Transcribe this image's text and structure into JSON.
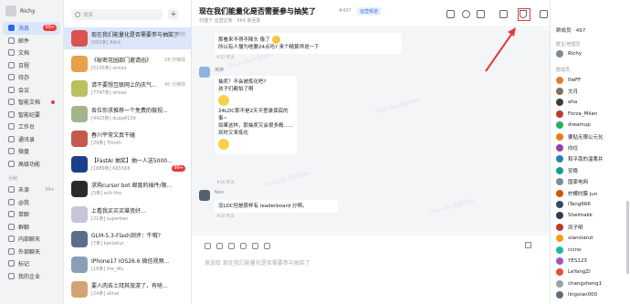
{
  "profile": {
    "name": "Richy"
  },
  "nav": {
    "items": [
      {
        "label": "消息",
        "badge": "99+",
        "active": true
      },
      {
        "label": "邮件"
      },
      {
        "label": "文档"
      },
      {
        "label": "日程"
      },
      {
        "label": "待办"
      },
      {
        "label": "会议"
      },
      {
        "label": "智能文档",
        "dot": true
      },
      {
        "label": "智能纪要"
      },
      {
        "label": "工作台"
      },
      {
        "label": "通讯录"
      },
      {
        "label": "微盘"
      },
      {
        "label": "高级功能"
      }
    ],
    "group_label": "分组",
    "groups": [
      {
        "label": "未读",
        "count": "99+"
      },
      {
        "label": "@我"
      },
      {
        "label": "单聊"
      },
      {
        "label": "群聊"
      },
      {
        "label": "内部聊天"
      },
      {
        "label": "外部聊天"
      },
      {
        "label": "标记"
      },
      {
        "label": "我的企业"
      }
    ]
  },
  "conversations": {
    "search_placeholder": "搜索",
    "add_label": "+",
    "items": [
      {
        "title": "现在我们能量化是否需要参与抽奖了",
        "sub": "[562条] Aitck",
        "time": "5 分钟前",
        "selected": true,
        "color": "#d9534f"
      },
      {
        "title": "《秘密花园部门邀请函》",
        "sub": "[5105条] xmiao",
        "time": "28 分钟前",
        "color": "#e8a04a"
      },
      {
        "title": "请不要想互联网上的庆气...",
        "sub": "[7747条] xmiao",
        "time": "40 分钟前",
        "color": "#b9c05e"
      },
      {
        "title": "各位你求推荐一个免费的做视...",
        "sub": "[4423条] duqq4139",
        "time": "",
        "color": "#a4b48e"
      },
      {
        "title": "春川平常文真干磕",
        "sub": "[29条] Throth",
        "time": "",
        "color": "#c25b4b"
      },
      {
        "title": "【FastAI 抽奖】抽一人送5000...",
        "sub": "[1889条] KK5566",
        "time": "",
        "badge": "99+",
        "color": "#1c3f8c"
      },
      {
        "title": "求购cursor bot 邮度的插件/限...",
        "sub": "[5条] erik-fire",
        "time": "",
        "color": "#2b2b2b"
      },
      {
        "title": "上看我买买买堪资好...",
        "sub": "[21条] superben",
        "time": "",
        "color": "#c7c3d8"
      },
      {
        "title": "GLM-5.3-Flash测评：牛哦?",
        "sub": "[7条] kanlatlur",
        "time": "",
        "color": "#5a6d8a"
      },
      {
        "title": "IPhone17 IOS26.6 微信视频...",
        "sub": "[18条] the_Wu",
        "time": "",
        "color": "#8a9fb7"
      },
      {
        "title": "要人肉去土拜其旅游了，有啥...",
        "sub": "[24条] alinai",
        "time": "",
        "color": "#d4a373"
      }
    ]
  },
  "chat": {
    "title": "现在我们能量化是否需要参与抽奖了",
    "number": "#497",
    "tag": "运营频道",
    "subtitle": "扫描下 运营这条 · 564 条回复",
    "msg1": {
      "text1": "那看来不得不降头 像了",
      "text2": "所以有人懂为啥要24点吗? 来个精算师说一下",
      "meta": "#17  昨天"
    },
    "msg2": {
      "name": "用神",
      "lines": [
        "抽奖？不会被炼化吧?",
        "孩子们都怕了啊"
      ],
      "lines2": [
        "24LDC那不是2天平登录保底的事~",
        "如果这样，那抽奖又会很多概......",
        "到时又来炼化"
      ],
      "meta": "#19  昨天"
    },
    "msg3": {
      "name": "Neo",
      "text": "没LDC但是那样有 leaderboard 分啊。",
      "meta": "#20  昨天"
    },
    "input_placeholder": "发送给 现在我们能量化是否需要参与抽奖了"
  },
  "members": {
    "header": "群成员 · 497",
    "sec_admin": "群主/管理员",
    "admin": [
      {
        "name": "Richy",
        "color": "#7a8a9a"
      }
    ],
    "sec_members": "群成员",
    "list": [
      {
        "name": "0wFF",
        "color": "#e07b39"
      },
      {
        "name": "文月",
        "color": "#8a6c5a"
      },
      {
        "name": "aha",
        "color": "#3a3a3a"
      },
      {
        "name": "Forza_Milan",
        "color": "#c0392b"
      },
      {
        "name": "dreamup",
        "color": "#27ae60"
      },
      {
        "name": "要贴无限公元化",
        "color": "#e67e22"
      },
      {
        "name": "向往",
        "color": "#8e44ad"
      },
      {
        "name": "和平南的温柔并",
        "color": "#2980b9"
      },
      {
        "name": "安稳",
        "color": "#16a085"
      },
      {
        "name": "国家电网",
        "color": "#7f8c8d"
      },
      {
        "name": "柠檬时膜 jun",
        "color": "#d35400"
      },
      {
        "name": "iTang666",
        "color": "#34495e"
      },
      {
        "name": "Shelmakk",
        "color": "#2c3e50"
      },
      {
        "name": "风子明",
        "color": "#c0392b"
      },
      {
        "name": "xianxianzi",
        "color": "#f39c12"
      },
      {
        "name": "ccino",
        "color": "#1abc9c"
      },
      {
        "name": "YES123",
        "color": "#9b59b6"
      },
      {
        "name": "LeYangZi",
        "color": "#e74c3c"
      },
      {
        "name": "changsheng1",
        "color": "#95a5a6"
      },
      {
        "name": "lingxian000",
        "color": "#5d6d7e"
      }
    ]
  },
  "watermark": "linux.do 内部资料"
}
